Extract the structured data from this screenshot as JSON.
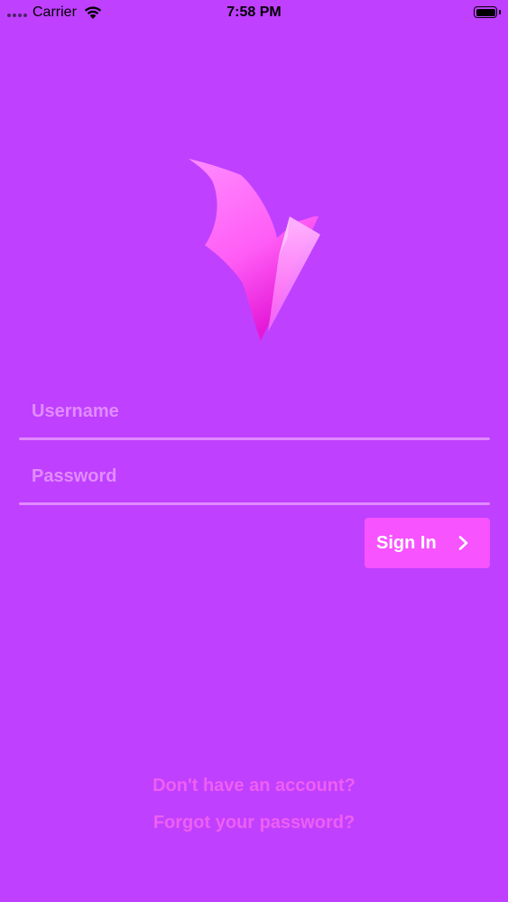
{
  "status_bar": {
    "carrier": "Carrier",
    "time": "7:58 PM"
  },
  "login": {
    "username_placeholder": "Username",
    "password_placeholder": "Password",
    "sign_in_label": "Sign In"
  },
  "links": {
    "no_account": "Don't have an account?",
    "forgot_password": "Forgot your password?"
  },
  "colors": {
    "background": "#bf40ff",
    "button": "#f753ff",
    "link": "#ee5ff2"
  },
  "icons": [
    "wifi-icon",
    "battery-icon",
    "logo-bird-icon",
    "chevron-right-icon"
  ]
}
